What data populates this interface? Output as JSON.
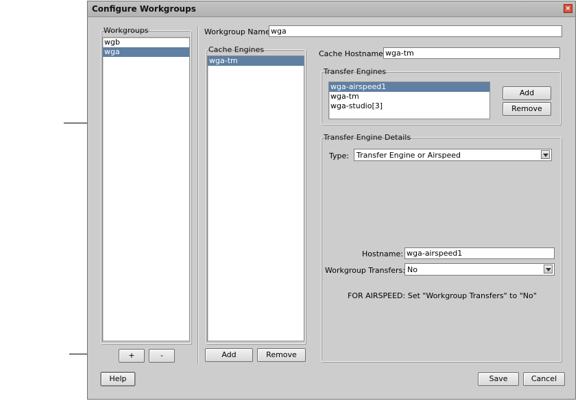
{
  "window": {
    "title": "Configure Workgroups"
  },
  "workgroups": {
    "legend": "Workgroups",
    "items": [
      {
        "label": "wgb",
        "selected": false
      },
      {
        "label": "wga",
        "selected": true
      }
    ],
    "add_label": "+",
    "remove_label": "-"
  },
  "workgroup_name": {
    "label": "Workgroup Name",
    "value": "wga"
  },
  "cache_engines": {
    "legend": "Cache Engines",
    "items": [
      {
        "label": "wga-tm",
        "selected": true
      }
    ],
    "add_label": "Add",
    "remove_label": "Remove"
  },
  "cache_hostname": {
    "label": "Cache Hostname:",
    "value": "wga-tm"
  },
  "transfer_engines": {
    "legend": "Transfer Engines",
    "items": [
      {
        "label": "wga-airspeed1",
        "selected": true
      },
      {
        "label": "wga-tm",
        "selected": false
      },
      {
        "label": "wga-studio[3]",
        "selected": false
      }
    ],
    "add_label": "Add",
    "remove_label": "Remove"
  },
  "details": {
    "legend": "Transfer Engine Details",
    "type_label": "Type:",
    "type_value": "Transfer Engine or Airspeed",
    "hostname_label": "Hostname:",
    "hostname_value": "wga-airspeed1",
    "wg_transfers_label": "Workgroup Transfers:",
    "wg_transfers_value": "No",
    "note": "FOR AIRSPEED: Set \"Workgroup Transfers\" to \"No\""
  },
  "footer": {
    "help_label": "Help",
    "save_label": "Save",
    "cancel_label": "Cancel"
  },
  "colors": {
    "selection": "#5f7fa3",
    "dialog_bg": "#cdcdcd",
    "close_button": "#d7543c"
  }
}
